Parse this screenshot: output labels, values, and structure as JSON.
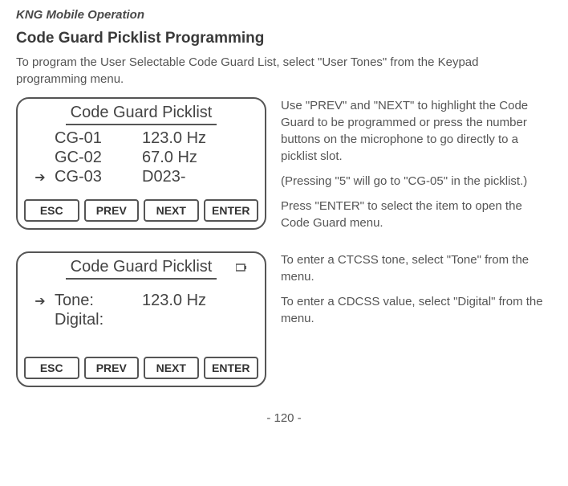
{
  "header": "KNG Mobile Operation",
  "section_title": "Code Guard Picklist Programming",
  "intro": "To program the User Selectable Code Guard List, select \"User Tones\" from the Keypad programming menu.",
  "screen1": {
    "title": "Code Guard Picklist",
    "rows": [
      {
        "selected": false,
        "c1": "CG-01",
        "c2": "123.0 Hz"
      },
      {
        "selected": false,
        "c1": "GC-02",
        "c2": "67.0  Hz"
      },
      {
        "selected": true,
        "c1": "CG-03",
        "c2": "D023-"
      }
    ],
    "buttons": {
      "b1": "ESC",
      "b2": "PREV",
      "b3": "NEXT",
      "b4": "ENTER"
    }
  },
  "side1": {
    "p1": "Use \"PREV\" and \"NEXT\" to highlight the Code Guard to be programmed or press the number buttons on the microphone to go directly to a picklist slot.",
    "p2": "(Pressing \"5\" will go to \"CG-05\" in the picklist.)",
    "p3": "Press \"ENTER\" to select the item to open the Code Guard menu."
  },
  "screen2": {
    "title": "Code Guard Picklist",
    "rows": [
      {
        "selected": true,
        "c1": "Tone:",
        "c2": "123.0 Hz"
      },
      {
        "selected": false,
        "c1": "Digital:",
        "c2": ""
      }
    ],
    "buttons": {
      "b1": "ESC",
      "b2": "PREV",
      "b3": "NEXT",
      "b4": "ENTER"
    }
  },
  "side2": {
    "p1": "To enter a CTCSS tone, select \"Tone\" from the menu.",
    "p2": "To enter a CDCSS value, select \"Digital\" from the menu."
  },
  "page_num": "- 120 -"
}
